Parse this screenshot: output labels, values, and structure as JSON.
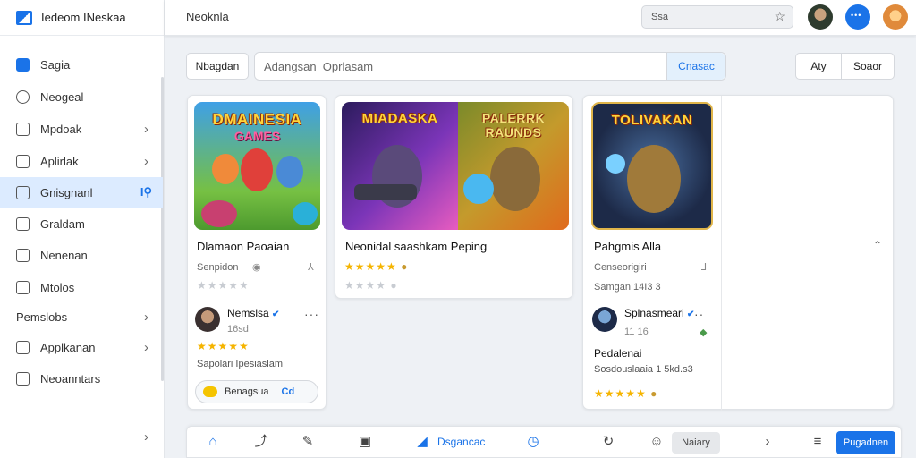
{
  "app": {
    "brand": "Iedeom INeskaa",
    "title": "Neoknla"
  },
  "topbar": {
    "search_value": "Ssa"
  },
  "sidebar": {
    "items": [
      {
        "label": "Sagia"
      },
      {
        "label": "Neogeal"
      },
      {
        "label": "Mpdoak"
      },
      {
        "label": "Aplirlak"
      },
      {
        "label": "Gnisgnanl"
      },
      {
        "label": "Graldam"
      },
      {
        "label": "Nenenan"
      },
      {
        "label": "Mtolos"
      },
      {
        "label": "Pemslobs"
      },
      {
        "label": "Applkanan"
      },
      {
        "label": "Neoanntars"
      }
    ]
  },
  "filters": {
    "left_chip": "Nbagdan",
    "search_placeholder": "Adangsan  Oprlasam",
    "search_button": "Cnasac",
    "right_chip_1": "Aty",
    "right_chip_2": "Soaor"
  },
  "cards": [
    {
      "thumb_title": "DMAINESIA",
      "thumb_sub": "GAMES",
      "title": "Dlamaon Paoaian",
      "category": "Senpidon",
      "user": "Nemslsa",
      "user_meta": "16sd",
      "description": "Sapolari Ipesiaslam",
      "pill_label": "Benagsua",
      "pill_tail": "Cd"
    },
    {
      "thumb_title_a": "MIADASKA",
      "thumb_title_b": "PALERRK RAUNDS",
      "title": "Neonidal saashkam Peping"
    },
    {
      "thumb_title": "TOLIVAKAN",
      "title": "Pahgmis Alla",
      "category": "Censeorigiri",
      "meta2": "Samgan 14I3 3",
      "user": "Splnasmeari",
      "user_meta": "11 16",
      "sub_title": "Pedalenai",
      "description": "Sosdouslaaia 1 5kd.s3"
    }
  ],
  "bottombar": {
    "active_label": "Dsgancac",
    "grey_button": "Naiary",
    "primary_button": "Pugadnen"
  },
  "colors": {
    "accent": "#1a73e8",
    "star": "#f5b400"
  }
}
